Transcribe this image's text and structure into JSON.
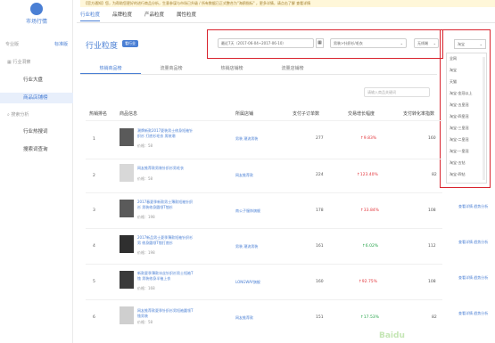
{
  "app": {
    "title": "市场行情"
  },
  "notice": "【官方通知】您，为帮助您更好的进行商品分析，生意参谋与市场已升级 / 所有数据已正式整合为\"海鸥指标\" ，更多详情，请点击了解 查看详情",
  "topnav": [
    "行业粒度",
    "品牌粒度",
    "产品粒度",
    "属性粒度"
  ],
  "sidebar": {
    "mode_tabs": [
      "专业版",
      "标准版"
    ],
    "groups": [
      "行业洞察",
      "搜索分析"
    ],
    "items": [
      "行业大盘",
      "商品店铺榜",
      "行业热搜词",
      "搜索词查询"
    ]
  },
  "page": {
    "title": "行业粒度",
    "badge": "看行业"
  },
  "filters": {
    "date": "最近7天（2017-06-04~2017-06-10）",
    "category": "男装>针织衫/毛衣",
    "terminal": "无线端",
    "platform": "淘宝"
  },
  "icons": {
    "calendar": "calendar-icon",
    "chevron": "chevron-down-icon"
  },
  "dropdown_options": [
    "全网",
    "淘宝",
    "天猫",
    "淘宝-金冠以上",
    "淘宝-五皇冠",
    "淘宝-四皇冠",
    "淘宝-三皇冠",
    "淘宝-二皇冠",
    "淘宝-一皇冠",
    "淘宝-五钻",
    "淘宝-四钻"
  ],
  "subtabs": [
    "热销商品榜",
    "流量商品榜",
    "热销店铺榜",
    "流量店铺榜"
  ],
  "search_placeholder": "请输入商品关键词",
  "table": {
    "headers": [
      "热销排名",
      "商品信息",
      "所属店铺",
      "支付子订单数",
      "交易增长幅度",
      "支付转化率指数",
      "操作"
    ],
    "rows": [
      {
        "rank": "1",
        "name": "潮牌新款2017夏装男士修身短袖针织衫 打底衫毛衣 男装潮",
        "price": "价格：58",
        "shop": "男装 潮流男装",
        "orders": "277",
        "growth": "9.83%",
        "growth_dir": "up",
        "conv": "160"
      },
      {
        "rank": "2",
        "name": "网友推荐款男装针织衫男毛衣",
        "price": "价格：58",
        "shop": "网友推荐款",
        "orders": "224",
        "growth": "123.40%",
        "growth_dir": "up",
        "conv": "82"
      },
      {
        "rank": "3",
        "name": "2017春夏季新款男士薄款短袖针织衫 男装修身圆领T恤衫",
        "price": "价格：198",
        "shop": "南公子服饰旗舰",
        "orders": "178",
        "growth": "33.84%",
        "growth_dir": "up",
        "conv": "108"
      },
      {
        "rank": "4",
        "name": "2017新品男士夏季薄款短袖针织衫男 修身圆领T恤打底衫",
        "price": "价格：198",
        "shop": "男装 潮流男装",
        "orders": "161",
        "growth": "6.02%",
        "growth_dir": "up",
        "conv": "112"
      },
      {
        "rank": "5",
        "name": "新款夏季薄款冰丝针织衫男士短袖T恤 男装修身半袖上衣",
        "price": "价格：168",
        "shop": "LONGWAY旗舰",
        "orders": "160",
        "growth": "92.75%",
        "growth_dir": "up",
        "conv": "108"
      },
      {
        "rank": "6",
        "name": "网友推荐款夏季针织衫男短袖圆领T恤男装",
        "price": "价格：58",
        "shop": "网友推荐款",
        "orders": "151",
        "growth": "17.53%",
        "growth_dir": "up",
        "conv": "82"
      }
    ],
    "action_text": "查看详情 趋势分析"
  },
  "watermark": "Baidu"
}
